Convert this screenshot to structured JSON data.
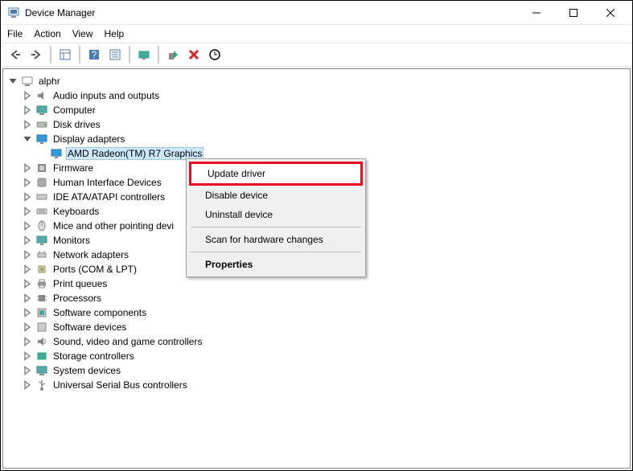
{
  "window": {
    "title": "Device Manager"
  },
  "menubar": [
    "File",
    "Action",
    "View",
    "Help"
  ],
  "tree": {
    "root": "alphr",
    "items": [
      "Audio inputs and outputs",
      "Computer",
      "Disk drives",
      "Display adapters",
      "AMD Radeon(TM) R7 Graphics",
      "Firmware",
      "Human Interface Devices",
      "IDE ATA/ATAPI controllers",
      "Keyboards",
      "Mice and other pointing devi",
      "Monitors",
      "Network adapters",
      "Ports (COM & LPT)",
      "Print queues",
      "Processors",
      "Software components",
      "Software devices",
      "Sound, video and game controllers",
      "Storage controllers",
      "System devices",
      "Universal Serial Bus controllers"
    ]
  },
  "context": {
    "update": "Update driver",
    "disable": "Disable device",
    "uninstall": "Uninstall device",
    "scan": "Scan for hardware changes",
    "properties": "Properties"
  }
}
